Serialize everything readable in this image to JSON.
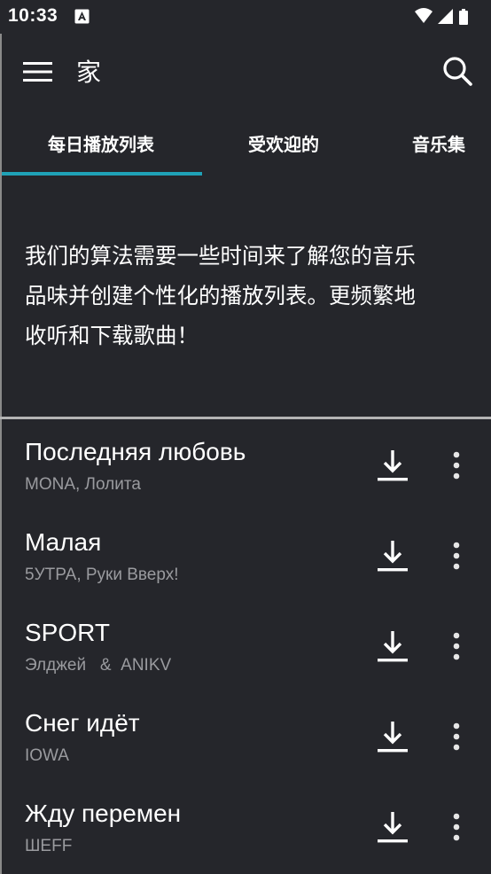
{
  "status_bar": {
    "time": "10:33"
  },
  "toolbar": {
    "title": "家",
    "menu_icon": "hamburger-menu-icon",
    "search_icon": "search-icon"
  },
  "tabs": [
    {
      "label": "每日播放列表",
      "selected": true
    },
    {
      "label": "受欢迎的",
      "selected": false
    },
    {
      "label": "音乐集",
      "selected": false
    }
  ],
  "message": {
    "lines": [
      "我们的算法需要一些时间来了解您的音乐",
      "品味并创建个性化的播放列表。更频繁地",
      "收听和下载歌曲！"
    ]
  },
  "songs": [
    {
      "title": "Последняя любовь",
      "artist": "MONA, Лолита"
    },
    {
      "title": "Малая",
      "artist": "5УТРА, Руки Вверх!"
    },
    {
      "title": "SPORT",
      "artist": "Элджей   &  ANIKV"
    },
    {
      "title": "Снег идёт",
      "artist": "IOWA"
    },
    {
      "title": "Жду перемен",
      "artist": "ШEFF"
    }
  ],
  "colors": {
    "background": "#25262b",
    "accent": "#1fa2b7",
    "secondary_text": "#9a9b9f",
    "divider": "#b4b4b4"
  }
}
